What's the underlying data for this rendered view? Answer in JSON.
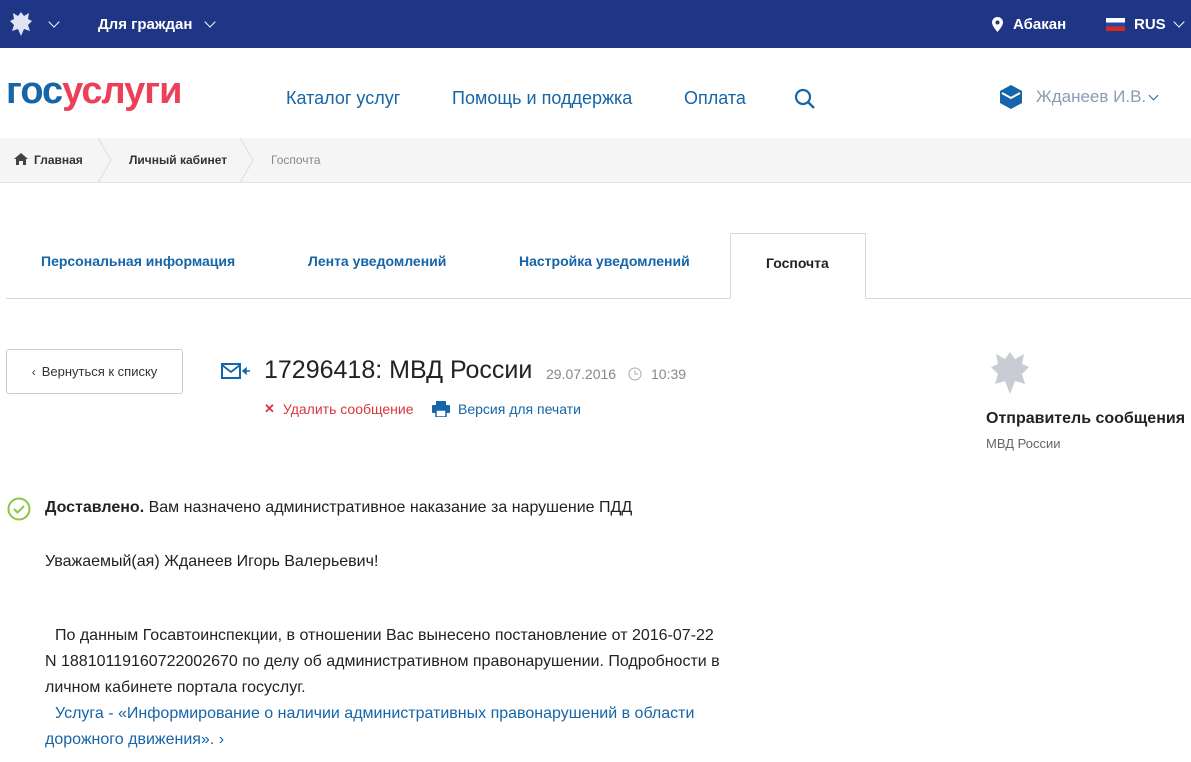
{
  "topbar": {
    "audience": "Для граждан",
    "city": "Абакан",
    "language": "RUS"
  },
  "header": {
    "logo_part1": "гос",
    "logo_part2": "услуги",
    "nav": [
      "Каталог услуг",
      "Помощь и поддержка",
      "Оплата"
    ],
    "user": "Жданеев И.В."
  },
  "breadcrumbs": [
    "Главная",
    "Личный кабинет",
    "Госпочта"
  ],
  "tabs": [
    "Персональная информация",
    "Лента уведомлений",
    "Настройка уведомлений",
    "Госпочта"
  ],
  "message": {
    "back": "Вернуться к списку",
    "title": "17296418: МВД России",
    "date": "29.07.2016",
    "time": "10:39",
    "delete": "Удалить сообщение",
    "print": "Версия для печати",
    "status": "Доставлено.",
    "subject": " Вам назначено административное наказание за нарушение ПДД",
    "greeting": "Уважаемый(ая) Жданеев Игорь Валерьевич!",
    "para1": "По данным Госавтоинспекции, в отношении Вас вынесено постановление от 2016-07-22",
    "para2": "N 18810119160722002670 по делу об административном правонарушении. Подробности в",
    "para3": "личном кабинете портала госуслуг.",
    "link1": "Услуга - «Информирование о наличии административных правонарушений в области",
    "link2": "дорожного движения»."
  },
  "sender": {
    "label": "Отправитель сообщения",
    "name": "МВД России"
  },
  "colors": {
    "topbar": "#1f3586",
    "link": "#1565a8",
    "logo_red": "#ee3f58",
    "delete": "#d9363e",
    "success": "#8dc63f"
  }
}
